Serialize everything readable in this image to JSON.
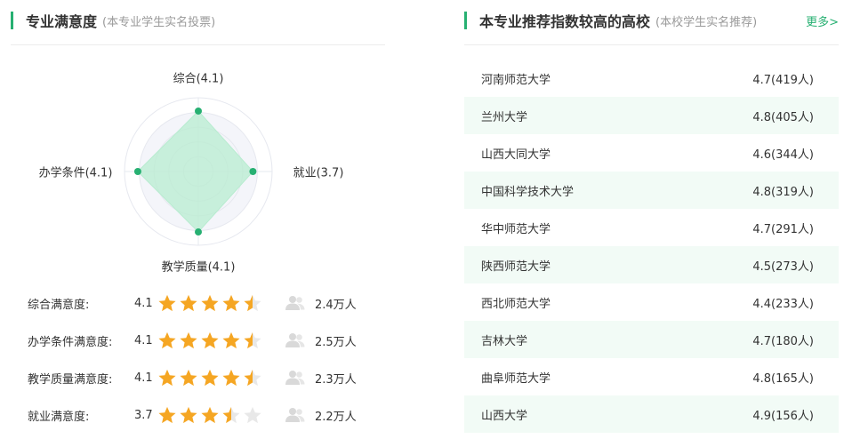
{
  "satisfaction": {
    "title": "专业满意度",
    "subtitle": "(本专业学生实名投票)",
    "radar": [
      {
        "label": "综合(4.1)",
        "value": 4.1
      },
      {
        "label": "就业(3.7)",
        "value": 3.7
      },
      {
        "label": "教学质量(4.1)",
        "value": 4.1
      },
      {
        "label": "办学条件(4.1)",
        "value": 4.1
      }
    ],
    "radar_max": 5,
    "colors": {
      "accent": "#27b072",
      "fill": "#b8ecd0",
      "grid": "#e6e8ef",
      "grid_fill": "#f4f5fa"
    },
    "ratings": [
      {
        "label": "综合满意度:",
        "score": "4.1",
        "stars": 4.5,
        "count": "2.4万人"
      },
      {
        "label": "办学条件满意度:",
        "score": "4.1",
        "stars": 4.5,
        "count": "2.5万人"
      },
      {
        "label": "教学质量满意度:",
        "score": "4.1",
        "stars": 4.5,
        "count": "2.3万人"
      },
      {
        "label": "就业满意度:",
        "score": "3.7",
        "stars": 3.5,
        "count": "2.2万人"
      }
    ],
    "star_color": "#f5a623",
    "star_empty_color": "#e8e8e8",
    "people_icon": "people-icon"
  },
  "recommend": {
    "title": "本专业推荐指数较高的高校",
    "subtitle": "(本校学生实名推荐)",
    "more": "更多>",
    "schools": [
      {
        "name": "河南师范大学",
        "rating": "4.7(419人)"
      },
      {
        "name": "兰州大学",
        "rating": "4.8(405人)"
      },
      {
        "name": "山西大同大学",
        "rating": "4.6(344人)"
      },
      {
        "name": "中国科学技术大学",
        "rating": "4.8(319人)"
      },
      {
        "name": "华中师范大学",
        "rating": "4.7(291人)"
      },
      {
        "name": "陕西师范大学",
        "rating": "4.5(273人)"
      },
      {
        "name": "西北师范大学",
        "rating": "4.4(233人)"
      },
      {
        "name": "吉林大学",
        "rating": "4.7(180人)"
      },
      {
        "name": "曲阜师范大学",
        "rating": "4.8(165人)"
      },
      {
        "name": "山西大学",
        "rating": "4.9(156人)"
      }
    ]
  }
}
